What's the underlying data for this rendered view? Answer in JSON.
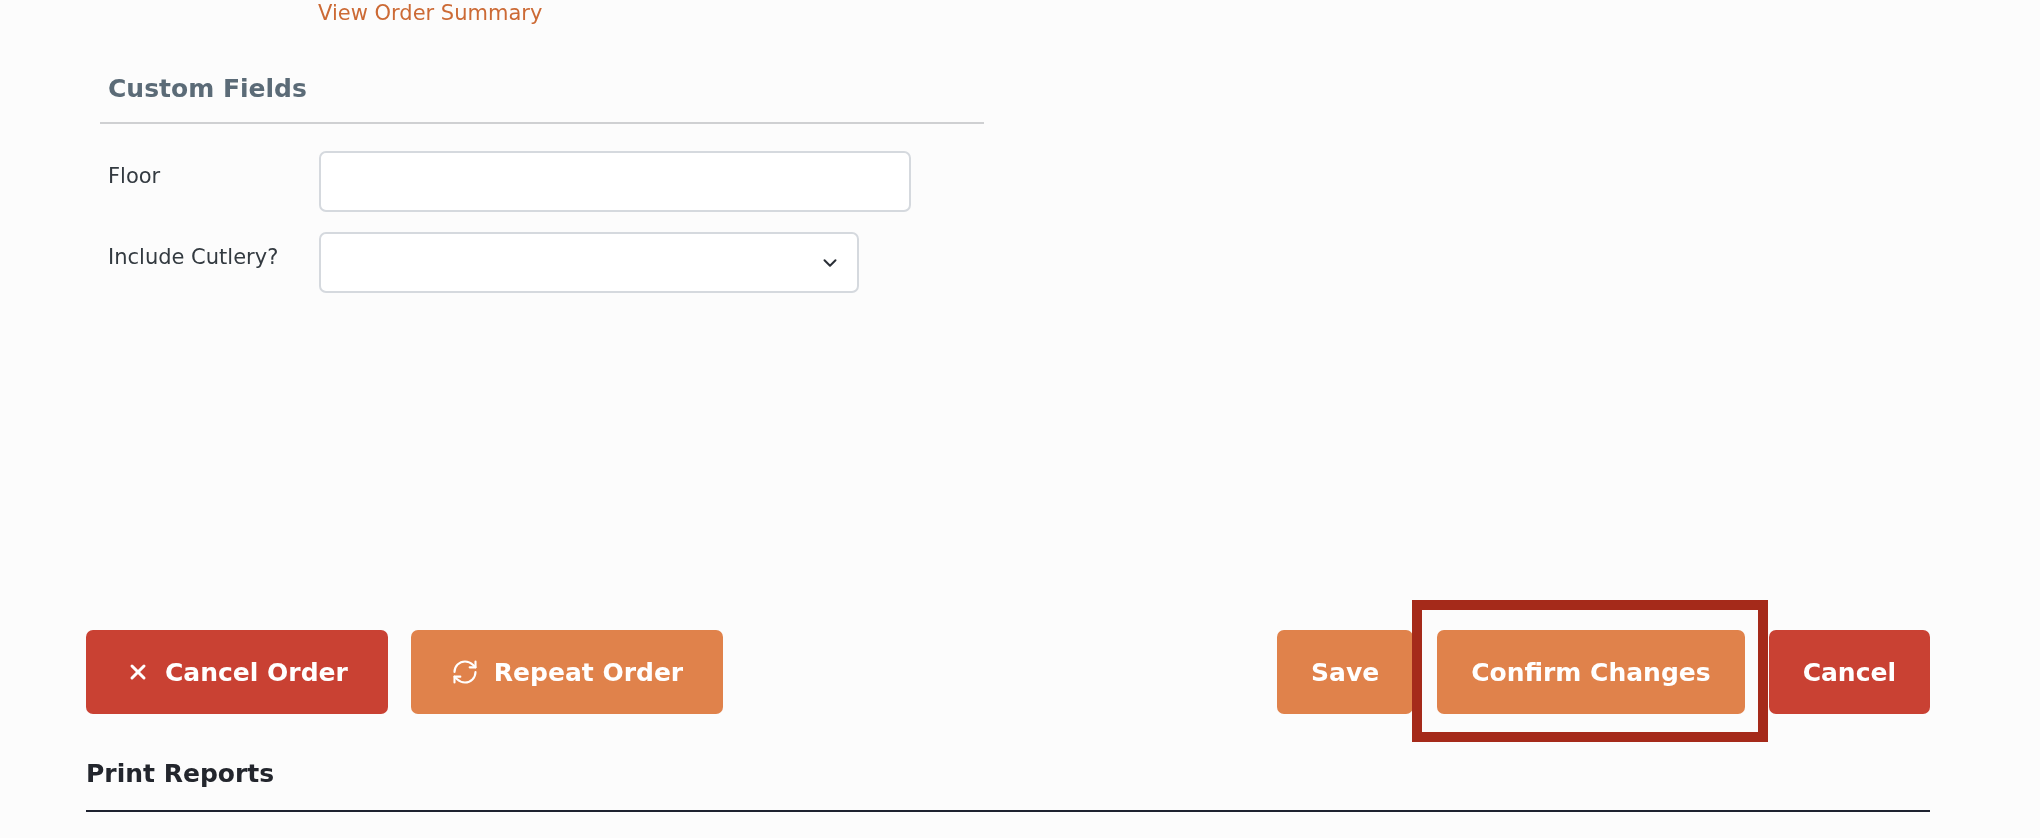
{
  "summary_link": "View Order Summary",
  "custom_fields": {
    "title": "Custom Fields",
    "fields": [
      {
        "kind": "text",
        "label": "Floor"
      },
      {
        "kind": "select",
        "label": "Include Cutlery?"
      }
    ]
  },
  "actions": {
    "left": [
      {
        "kind": "close",
        "label": "Cancel Order",
        "color": "#c94133",
        "highlighted": false
      },
      {
        "kind": "repeat",
        "label": "Repeat Order",
        "color": "#e0824b",
        "highlighted": false
      }
    ],
    "right": [
      {
        "kind": "plain",
        "label": "Save",
        "color": "#e0824b",
        "highlighted": false
      },
      {
        "kind": "plain",
        "label": "Confirm Changes",
        "color": "#e0824b",
        "highlighted": true
      },
      {
        "kind": "plain",
        "label": "Cancel",
        "color": "#c94133",
        "highlighted": false
      }
    ]
  },
  "print_reports": {
    "title": "Print Reports"
  }
}
